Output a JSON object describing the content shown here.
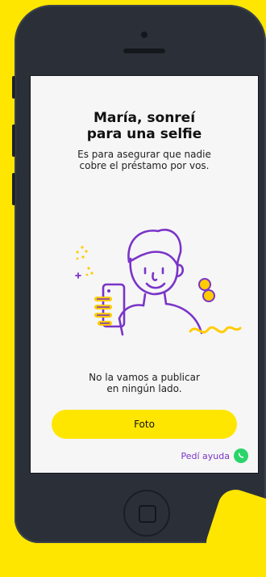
{
  "screen": {
    "title_line1": "María, sonreí",
    "title_line2": "para una selfie",
    "subtitle_line1": "Es para asegurar que nadie",
    "subtitle_line2": "cobre el préstamo por vos.",
    "note_line1": "No la vamos a publicar",
    "note_line2": "en ningún lado.",
    "primary_button_label": "Foto",
    "help_link_label": "Pedí ayuda",
    "help_icon": "whatsapp-icon",
    "illustration": "selfie-person-illustration"
  },
  "colors": {
    "accent_yellow": "#ffe600",
    "accent_purple": "#7a34c8",
    "whatsapp_green": "#2bd46b",
    "phone_body": "#2b3038"
  }
}
